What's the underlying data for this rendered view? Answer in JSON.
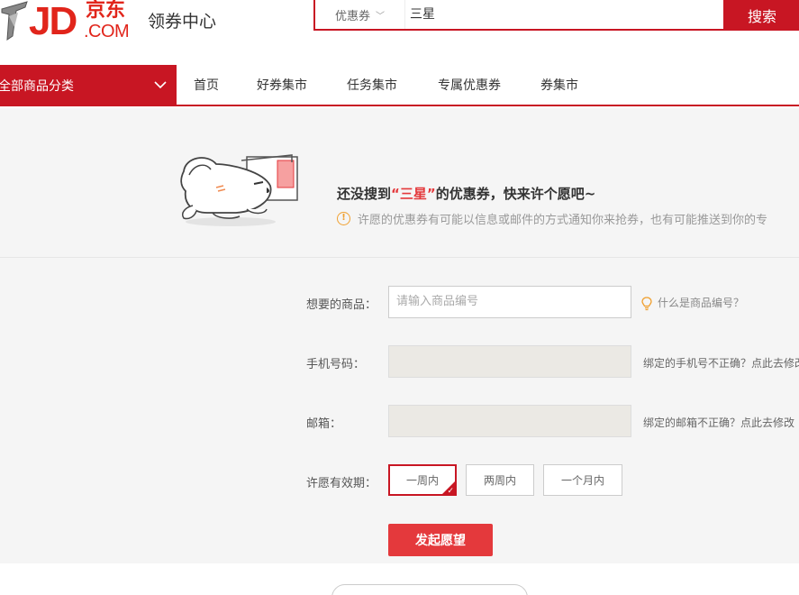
{
  "header": {
    "logo_text": "JD",
    "logo_cn": "京东",
    "logo_com": ".COM",
    "site_title": "领券中心",
    "search": {
      "category": "优惠券",
      "query": "三星",
      "button": "搜索"
    }
  },
  "nav": {
    "all_categories": "全部商品分类",
    "links": [
      "首页",
      "好券集市",
      "任务集市",
      "专属优惠券",
      "券集市"
    ]
  },
  "hero": {
    "title_prefix": "还没搜到",
    "keyword": "“三星”",
    "title_suffix": "的优惠券，快来许个愿吧~",
    "tip": "许愿的优惠券有可能以信息或邮件的方式通知你来抢券，也有可能推送到你的专"
  },
  "form": {
    "product_label": "想要的商品：",
    "product_placeholder": "请输入商品编号",
    "product_help": "什么是商品编号？",
    "phone_label": "手机号码：",
    "phone_note": "绑定的手机号不正确？点此去修改",
    "email_label": "邮箱：",
    "email_note": "绑定的邮箱不正确？点此去修改",
    "validity_label": "许愿有效期：",
    "periods": [
      "一周内",
      "两周内",
      "一个月内"
    ],
    "selected_period": "一周内",
    "submit": "发起愿望"
  },
  "colors": {
    "brand_red": "#c81623",
    "accent_red": "#e4393c",
    "warn_orange": "#f0a030"
  }
}
